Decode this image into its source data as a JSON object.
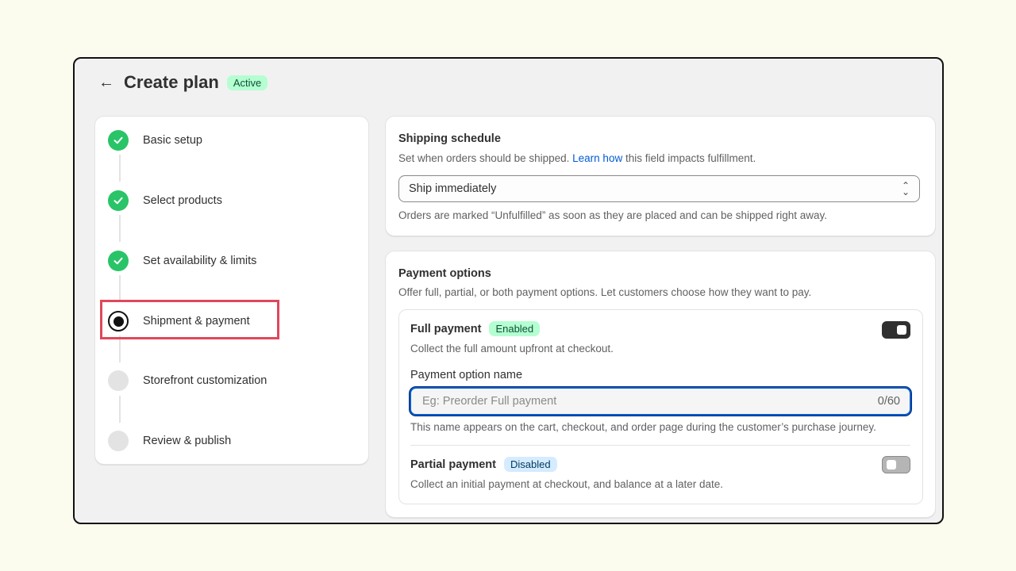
{
  "header": {
    "back_icon": "arrow-left-icon",
    "title": "Create plan",
    "status_badge": "Active"
  },
  "steps": [
    {
      "label": "Basic setup",
      "state": "done"
    },
    {
      "label": "Select products",
      "state": "done"
    },
    {
      "label": "Set availability & limits",
      "state": "done"
    },
    {
      "label": "Shipment & payment",
      "state": "current"
    },
    {
      "label": "Storefront customization",
      "state": "todo"
    },
    {
      "label": "Review & publish",
      "state": "todo"
    }
  ],
  "shipping": {
    "title": "Shipping schedule",
    "desc_before": "Set when orders should be shipped. ",
    "desc_link": "Learn how",
    "desc_after": " this field impacts fulfillment.",
    "select_value": "Ship immediately",
    "help": "Orders are marked “Unfulfilled” as soon as they are placed and can be shipped right away."
  },
  "payment": {
    "title": "Payment options",
    "desc": "Offer full, partial, or both payment options. Let customers choose how they want to pay.",
    "full": {
      "title": "Full payment",
      "badge": "Enabled",
      "desc": "Collect the full amount upfront at checkout.",
      "enabled": true,
      "field_label": "Payment option name",
      "placeholder": "Eg: Preorder Full payment",
      "value": "",
      "char_count": "0/60",
      "field_help": "This name appears on the cart, checkout, and order page during the customer’s purchase journey."
    },
    "partial": {
      "title": "Partial payment",
      "badge": "Disabled",
      "desc": "Collect an initial payment at checkout, and balance at a later date.",
      "enabled": false
    }
  },
  "colors": {
    "done": "#29c467",
    "highlight": "#e0475a",
    "link": "#005bd3",
    "focus": "#005bd3"
  }
}
